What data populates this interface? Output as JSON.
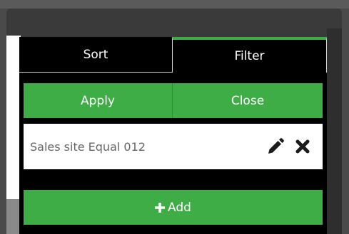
{
  "tabs": {
    "sort_label": "Sort",
    "filter_label": "Filter"
  },
  "actions": {
    "apply_label": "Apply",
    "close_label": "Close"
  },
  "filters": [
    {
      "text": "Sales site Equal 012",
      "edit_icon": "pencil-icon",
      "delete_icon": "x-icon"
    }
  ],
  "add": {
    "label": "Add",
    "icon": "plus-icon"
  },
  "colors": {
    "accent": "#3fad46",
    "panel_bg": "#000000"
  }
}
